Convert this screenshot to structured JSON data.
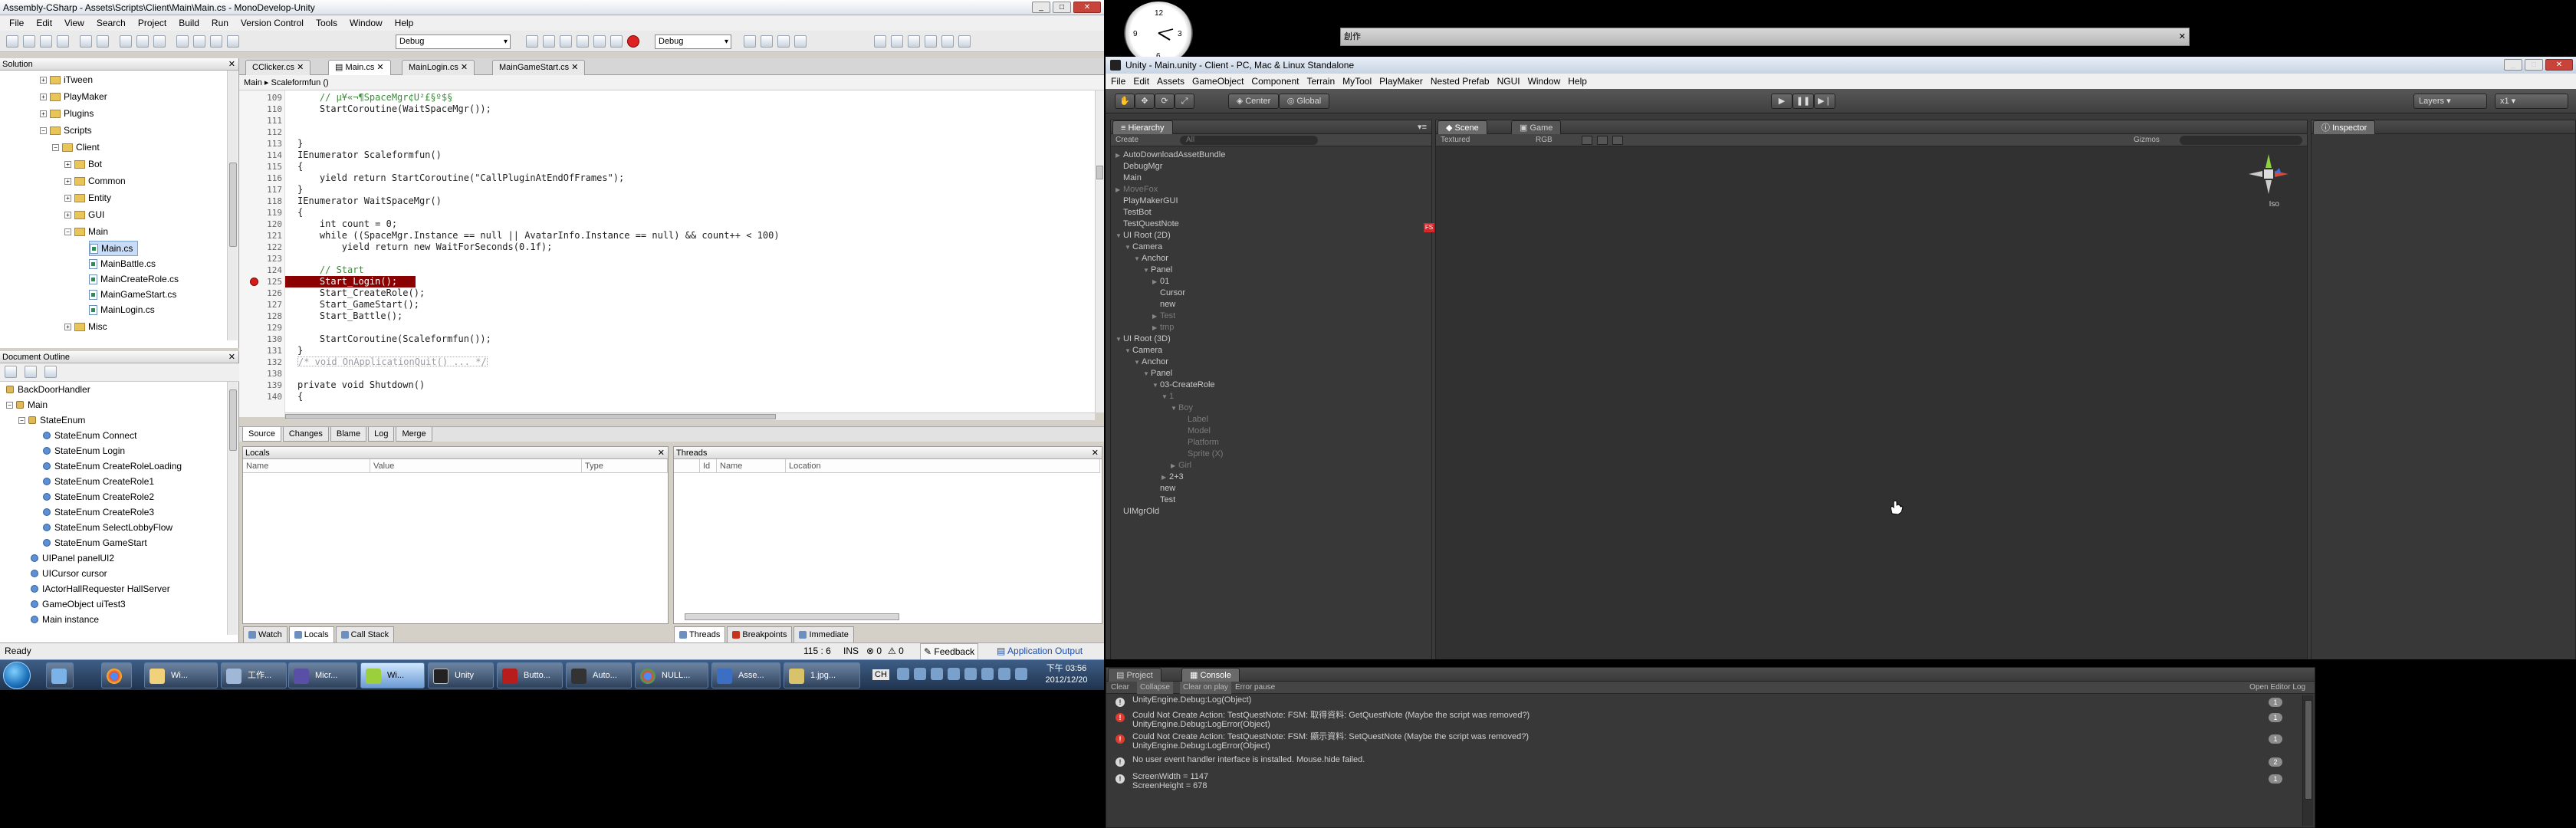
{
  "monodevelop": {
    "title": "Assembly-CSharp - Assets\\Scripts\\Client\\Main\\Main.cs - MonoDevelop-Unity",
    "menu": [
      "File",
      "Edit",
      "View",
      "Search",
      "Project",
      "Build",
      "Run",
      "Version Control",
      "Tools",
      "Window",
      "Help"
    ],
    "toolbar": {
      "config_combo": "Debug",
      "platform_combo": "Debug"
    },
    "solution_pad": {
      "title": "Solution",
      "items": [
        {
          "label": "iTween",
          "kind": "folder"
        },
        {
          "label": "PlayMaker",
          "kind": "folder"
        },
        {
          "label": "Plugins",
          "kind": "folder"
        },
        {
          "label": "Scripts",
          "kind": "folder"
        },
        {
          "label": "Client",
          "kind": "folder"
        },
        {
          "label": "Bot",
          "kind": "folder"
        },
        {
          "label": "Common",
          "kind": "folder"
        },
        {
          "label": "Entity",
          "kind": "folder"
        },
        {
          "label": "GUI",
          "kind": "folder"
        },
        {
          "label": "Main",
          "kind": "folder"
        },
        {
          "label": "Main.cs",
          "kind": "file"
        },
        {
          "label": "MainBattle.cs",
          "kind": "file"
        },
        {
          "label": "MainCreateRole.cs",
          "kind": "file"
        },
        {
          "label": "MainGameStart.cs",
          "kind": "file"
        },
        {
          "label": "MainLogin.cs",
          "kind": "file"
        },
        {
          "label": "Misc",
          "kind": "folder"
        }
      ]
    },
    "outline_pad": {
      "title": "Document Outline",
      "items": [
        "BackDoorHandler",
        "Main",
        "StateEnum",
        "StateEnum Connect",
        "StateEnum Login",
        "StateEnum CreateRoleLoading",
        "StateEnum CreateRole1",
        "StateEnum CreateRole2",
        "StateEnum CreateRole3",
        "StateEnum SelectLobbyFlow",
        "StateEnum GameStart",
        "UIPanel panelUI2",
        "UICursor cursor",
        "IActorHallRequester HallServer",
        "GameObject uiTest3",
        "Main instance"
      ]
    },
    "tabs": [
      "CClicker.cs",
      "Main.cs",
      "MainLogin.cs",
      "MainGameStart.cs"
    ],
    "breadcrumb": [
      "Main",
      "Scaleformfun ()"
    ],
    "code_lines": [
      {
        "n": "109",
        "text": "    // µ¥«¬¶SpaceMgr¢U²£§º$§",
        "cls": "cm"
      },
      {
        "n": "110",
        "text": "    StartCoroutine(WaitSpaceMgr());",
        "cls": ""
      },
      {
        "n": "111",
        "text": "",
        "cls": ""
      },
      {
        "n": "112",
        "text": "",
        "cls": ""
      },
      {
        "n": "113",
        "text": "}",
        "cls": ""
      },
      {
        "n": "114",
        "text": "IEnumerator Scaleformfun()",
        "cls": ""
      },
      {
        "n": "115",
        "text": "{",
        "cls": ""
      },
      {
        "n": "116",
        "text": "    yield return StartCoroutine(\"CallPluginAtEndOfFrames\");",
        "cls": ""
      },
      {
        "n": "117",
        "text": "}",
        "cls": ""
      },
      {
        "n": "118",
        "text": "IEnumerator WaitSpaceMgr()",
        "cls": ""
      },
      {
        "n": "119",
        "text": "{",
        "cls": ""
      },
      {
        "n": "120",
        "text": "    int count = 0;",
        "cls": ""
      },
      {
        "n": "121",
        "text": "    while ((SpaceMgr.Instance == null || AvatarInfo.Instance == null) && count++ < 100)",
        "cls": ""
      },
      {
        "n": "122",
        "text": "        yield return new WaitForSeconds(0.1f);",
        "cls": ""
      },
      {
        "n": "123",
        "text": "",
        "cls": ""
      },
      {
        "n": "124",
        "text": "    // Start",
        "cls": "cm"
      },
      {
        "n": "125",
        "text": "    Start_Login();",
        "cls": "bp"
      },
      {
        "n": "126",
        "text": "    Start_CreateRole();",
        "cls": ""
      },
      {
        "n": "127",
        "text": "    Start_GameStart();",
        "cls": ""
      },
      {
        "n": "128",
        "text": "    Start_Battle();",
        "cls": ""
      },
      {
        "n": "129",
        "text": "",
        "cls": ""
      },
      {
        "n": "130",
        "text": "    StartCoroutine(Scaleformfun());",
        "cls": ""
      },
      {
        "n": "131",
        "text": "}",
        "cls": ""
      },
      {
        "n": "132",
        "text": "/* void OnApplicationQuit() ... */",
        "cls": "fold"
      },
      {
        "n": "138",
        "text": "",
        "cls": ""
      },
      {
        "n": "139",
        "text": "private void Shutdown()",
        "cls": ""
      },
      {
        "n": "140",
        "text": "{",
        "cls": ""
      }
    ],
    "source_tabs": [
      "Source",
      "Changes",
      "Blame",
      "Log",
      "Merge"
    ],
    "locals_pad": {
      "title": "Locals",
      "columns": [
        "Name",
        "Value",
        "Type"
      ]
    },
    "threads_pad": {
      "title": "Threads",
      "columns": [
        "Id",
        "Name",
        "Location"
      ]
    },
    "locals_tabs": [
      "Watch",
      "Locals",
      "Call Stack"
    ],
    "threads_tabs": [
      "Threads",
      "Breakpoints",
      "Immediate"
    ],
    "status": {
      "text": "Ready",
      "position": "115 : 6",
      "mode": "INS",
      "errors": "0",
      "warnings": "0",
      "feedback": "Feedback",
      "output": "Application Output"
    }
  },
  "taskbar": {
    "items": [
      "Wi...",
      "工作...",
      "Micr...",
      "Wi...",
      "Unity",
      "Butto...",
      "Auto...",
      "NULL...",
      "Asse...",
      "1.jpg..."
    ],
    "clock_time": "下午 03:56",
    "clock_date": "2012/12/20",
    "ime": "CH"
  },
  "background_window": {
    "title": "創作"
  },
  "unity": {
    "title": "Unity - Main.unity - Client - PC, Mac & Linux Standalone",
    "menu": [
      "File",
      "Edit",
      "Assets",
      "GameObject",
      "Component",
      "Terrain",
      "MyTool",
      "PlayMaker",
      "Nested Prefab",
      "NGUI",
      "Window",
      "Help"
    ],
    "toolbar": {
      "center": "Center",
      "global": "Global",
      "layers": "Layers",
      "layout": "x1"
    },
    "hierarchy": {
      "title": "Hierarchy",
      "create": "Create",
      "search_placeholder": "All",
      "items": [
        {
          "label": "AutoDownloadAssetBundle",
          "depth": 0,
          "exp": "▶",
          "dim": false
        },
        {
          "label": "DebugMgr",
          "depth": 0,
          "exp": "",
          "dim": false
        },
        {
          "label": "Main",
          "depth": 0,
          "exp": "",
          "dim": false
        },
        {
          "label": "MoveFox",
          "depth": 0,
          "exp": "▶",
          "dim": true
        },
        {
          "label": "PlayMakerGUI",
          "depth": 0,
          "exp": "",
          "dim": false
        },
        {
          "label": "TestBot",
          "depth": 0,
          "exp": "",
          "dim": false
        },
        {
          "label": "TestQuestNote",
          "depth": 0,
          "exp": "",
          "dim": false
        },
        {
          "label": "UI Root (2D)",
          "depth": 0,
          "exp": "▼",
          "dim": false
        },
        {
          "label": "Camera",
          "depth": 1,
          "exp": "▼",
          "dim": false
        },
        {
          "label": "Anchor",
          "depth": 2,
          "exp": "▼",
          "dim": false
        },
        {
          "label": "Panel",
          "depth": 3,
          "exp": "▼",
          "dim": false
        },
        {
          "label": "01",
          "depth": 4,
          "exp": "▶",
          "dim": false
        },
        {
          "label": "Cursor",
          "depth": 4,
          "exp": "",
          "dim": false
        },
        {
          "label": "new",
          "depth": 4,
          "exp": "",
          "dim": false
        },
        {
          "label": "Test",
          "depth": 4,
          "exp": "▶",
          "dim": true
        },
        {
          "label": "tmp",
          "depth": 4,
          "exp": "▶",
          "dim": true
        },
        {
          "label": "UI Root (3D)",
          "depth": 0,
          "exp": "▼",
          "dim": false
        },
        {
          "label": "Camera",
          "depth": 1,
          "exp": "▼",
          "dim": false
        },
        {
          "label": "Anchor",
          "depth": 2,
          "exp": "▼",
          "dim": false
        },
        {
          "label": "Panel",
          "depth": 3,
          "exp": "▼",
          "dim": false
        },
        {
          "label": "03-CreateRole",
          "depth": 4,
          "exp": "▼",
          "dim": false
        },
        {
          "label": "1",
          "depth": 5,
          "exp": "▼",
          "dim": true
        },
        {
          "label": "Boy",
          "depth": 6,
          "exp": "▼",
          "dim": true
        },
        {
          "label": "Label",
          "depth": 7,
          "exp": "",
          "dim": true
        },
        {
          "label": "Model",
          "depth": 7,
          "exp": "",
          "dim": true
        },
        {
          "label": "Platform",
          "depth": 7,
          "exp": "",
          "dim": true
        },
        {
          "label": "Sprite (X)",
          "depth": 7,
          "exp": "",
          "dim": true
        },
        {
          "label": "Girl",
          "depth": 6,
          "exp": "▶",
          "dim": true
        },
        {
          "label": "2+3",
          "depth": 5,
          "exp": "▶",
          "dim": false
        },
        {
          "label": "new",
          "depth": 4,
          "exp": "",
          "dim": false
        },
        {
          "label": "Test",
          "depth": 4,
          "exp": "",
          "dim": false
        },
        {
          "label": "UIMgrOld",
          "depth": 0,
          "exp": "",
          "dim": false
        }
      ]
    },
    "scene": {
      "tabs": [
        "Scene",
        "Game"
      ],
      "shading": "Textured",
      "render": "RGB",
      "gizmos": "Gizmos",
      "persp": "Iso"
    },
    "inspector": {
      "title": "Inspector"
    },
    "console": {
      "tabs": [
        "Project",
        "Console"
      ],
      "buttons": [
        "Clear",
        "Collapse",
        "Clear on play",
        "Error pause"
      ],
      "open_editor_log": "Open Editor Log",
      "entries": [
        {
          "type": "info",
          "line1": "UnityEngine.Debug:Log(Object)",
          "line2": "",
          "count": "1"
        },
        {
          "type": "error",
          "line1": "Could Not Create Action: TestQuestNote: FSM: 取得資料: GetQuestNote (Maybe the script was removed?)",
          "line2": "UnityEngine.Debug:LogError(Object)",
          "count": "1"
        },
        {
          "type": "error",
          "line1": "Could Not Create Action: TestQuestNote: FSM: 顯示資料: SetQuestNote (Maybe the script was removed?)",
          "line2": "UnityEngine.Debug:LogError(Object)",
          "count": "1"
        },
        {
          "type": "info",
          "line1": "No user event handler interface is installed. Mouse.hide failed.",
          "line2": "",
          "count": "2"
        },
        {
          "type": "info",
          "line1": "ScreenWidth = 1147",
          "line2": "ScreenHeight = 678",
          "count": "1"
        }
      ]
    }
  }
}
